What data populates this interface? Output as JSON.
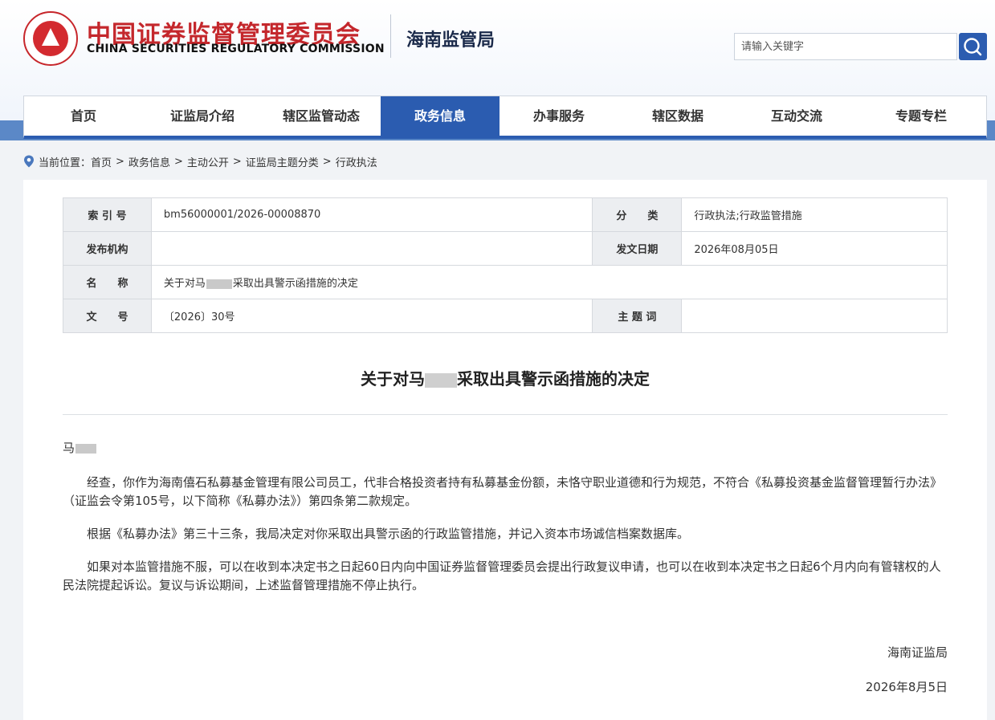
{
  "header": {
    "org_name_cn": "中国证券监督管理委员会",
    "org_name_en": "CHINA SECURITIES REGULATORY COMMISSION",
    "bureau_name": "海南监管局",
    "search_placeholder": "请输入关键字",
    "search_icon": "search-icon"
  },
  "nav": {
    "items": [
      {
        "label": "首页"
      },
      {
        "label": "证监局介绍"
      },
      {
        "label": "辖区监管动态"
      },
      {
        "label": "政务信息",
        "active": true
      },
      {
        "label": "办事服务"
      },
      {
        "label": "辖区数据"
      },
      {
        "label": "互动交流"
      },
      {
        "label": "专题专栏"
      }
    ],
    "active_color": "#2b5cb0"
  },
  "breadcrumb": {
    "prefix": "当前位置：",
    "items": [
      "首页",
      "政务信息",
      "主动公开",
      "证监局主题分类",
      "行政执法"
    ],
    "separator": ">"
  },
  "meta": {
    "index_label": "索 引 号",
    "index_value": "bm56000001/2026-00008870",
    "category_label": "分　　类",
    "category_value": "行政执法;行政监管措施",
    "issuer_label": "发布机构",
    "issuer_value": "",
    "date_label": "发文日期",
    "date_value": "2026年08月05日",
    "name_label": "名　　称",
    "name_prefix": "关于对马",
    "name_suffix": "采取出具警示函措施的决定",
    "docno_label": "文　　号",
    "docno_value": "〔2026〕30号",
    "keywords_label": "主 题 词",
    "keywords_value": ""
  },
  "document": {
    "title_prefix": "关于对马",
    "title_suffix": "采取出具警示函措施的决定",
    "addressee": "马",
    "paragraphs": [
      "经查，你作为海南僖石私募基金管理有限公司员工，代非合格投资者持有私募基金份额，未恪守职业道德和行为规范，不符合《私募投资基金监督管理暂行办法》（证监会令第105号，以下简称《私募办法》）第四条第二款规定。",
      "根据《私募办法》第三十三条，我局决定对你采取出具警示函的行政监管措施，并记入资本市场诚信档案数据库。",
      "如果对本监管措施不服，可以在收到本决定书之日起60日内向中国证券监督管理委员会提出行政复议申请，也可以在收到本决定书之日起6个月内向有管辖权的人民法院提起诉讼。复议与诉讼期间，上述监督管理措施不停止执行。"
    ],
    "signature": "海南证监局",
    "signed_date": "2026年8月5日"
  }
}
